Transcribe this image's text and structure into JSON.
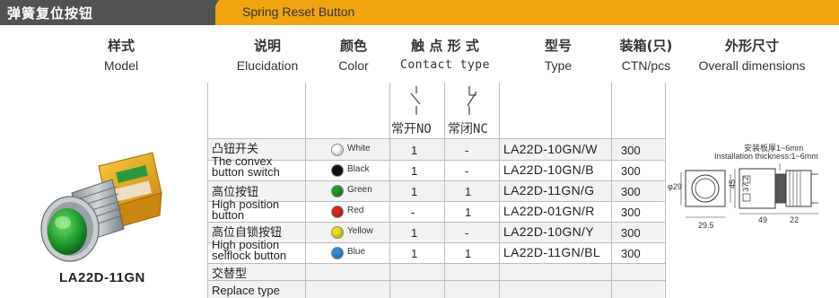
{
  "banner": {
    "title_cn": "弹簧复位按钮",
    "title_en": "Spring Reset Button",
    "left_color": "#525252",
    "right_color": "#f1a40f"
  },
  "headers": {
    "model": {
      "cn": "样式",
      "en": "Model"
    },
    "elucidation": {
      "cn": "说明",
      "en": "Elucidation"
    },
    "color": {
      "cn": "颜色",
      "en": "Color"
    },
    "contact": {
      "cn": "触 点 形 式",
      "en": "Contact type"
    },
    "type": {
      "cn": "型号",
      "en": "Type"
    },
    "ctn": {
      "cn": "装箱(只)",
      "en": "CTN/pcs"
    },
    "dims": {
      "cn": "外形尺寸",
      "en": "Overall dimensions"
    }
  },
  "contact_types": {
    "no": "常开NO",
    "nc": "常闭NC"
  },
  "categories": [
    {
      "cn": "凸钮开关",
      "en": [
        "The convex",
        "button switch"
      ]
    },
    {
      "cn": "高位按钮",
      "en": [
        "High position",
        "button"
      ]
    },
    {
      "cn": "高位自锁按钮",
      "en": [
        "High position",
        "selflock button"
      ]
    },
    {
      "cn": "交替型",
      "en": [
        "Replace type"
      ]
    }
  ],
  "rows": [
    {
      "color": "White",
      "hex": "#ffffff",
      "no": "1",
      "nc": "-",
      "model": "LA22D-10GN/W",
      "ctn": "300"
    },
    {
      "color": "Black",
      "hex": "#111111",
      "no": "1",
      "nc": "-",
      "model": "LA22D-10GN/B",
      "ctn": "300"
    },
    {
      "color": "Green",
      "hex": "#1f9a2e",
      "no": "1",
      "nc": "1",
      "model": "LA22D-11GN/G",
      "ctn": "300"
    },
    {
      "color": "Red",
      "hex": "#d9261c",
      "no": "-",
      "nc": "1",
      "model": "LA22D-01GN/R",
      "ctn": "300"
    },
    {
      "color": "Yellow",
      "hex": "#f4de1b",
      "no": "1",
      "nc": "-",
      "model": "LA22D-10GN/Y",
      "ctn": "300"
    },
    {
      "color": "Blue",
      "hex": "#2a8fdc",
      "no": "1",
      "nc": "1",
      "model": "LA22D-11GN/BL",
      "ctn": "300"
    }
  ],
  "product": {
    "label": "LA22D-11GN"
  },
  "drawing": {
    "panel_cn": "安装板厚1~6mm",
    "panel_en": "Installation thickness:1~6mm",
    "d_dia": "φ29",
    "d_w1": "29.5",
    "d_h1": "37.2",
    "d_h2": "45",
    "d_len": "49",
    "d_thk": "22"
  }
}
